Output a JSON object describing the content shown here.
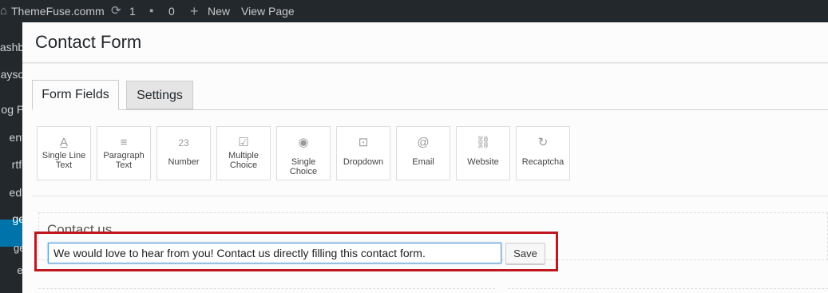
{
  "admin_bar": {
    "site_name": "ThemeFuse.comm",
    "updates_count": "1",
    "comments_count": "0",
    "new_label": "New",
    "view_page_label": "View Page"
  },
  "side_menu": {
    "items": [
      "ashbo",
      "ayson",
      "og Po",
      "ents",
      "rtfol",
      "edia",
      "ges",
      "ges",
      "ew"
    ]
  },
  "modal": {
    "title": "Contact Form"
  },
  "tabs": [
    {
      "label": "Form Fields",
      "active": true
    },
    {
      "label": "Settings",
      "active": false
    }
  ],
  "fields": [
    {
      "label_line1": "Single Line",
      "label_line2": "Text",
      "icon": "text-icon"
    },
    {
      "label_line1": "Paragraph",
      "label_line2": "Text",
      "icon": "paragraph-icon"
    },
    {
      "label_line1": "Number",
      "label_line2": "",
      "icon": "number-icon"
    },
    {
      "label_line1": "Multiple",
      "label_line2": "Choice",
      "icon": "checkbox-icon"
    },
    {
      "label_line1": "Single Choice",
      "label_line2": "",
      "icon": "radio-icon"
    },
    {
      "label_line1": "Dropdown",
      "label_line2": "",
      "icon": "dropdown-icon"
    },
    {
      "label_line1": "Email",
      "label_line2": "",
      "icon": "at-icon"
    },
    {
      "label_line1": "Website",
      "label_line2": "",
      "icon": "link-icon"
    },
    {
      "label_line1": "Recaptcha",
      "label_line2": "",
      "icon": "refresh-icon"
    }
  ],
  "section": {
    "title": "Contact us",
    "input_value": "We would love to hear from you! Contact us directly filling this contact form.",
    "save_label": "Save"
  },
  "colors": {
    "highlight": "#c0161d",
    "admin_bar": "#23282d",
    "active_menu": "#0073aa"
  }
}
